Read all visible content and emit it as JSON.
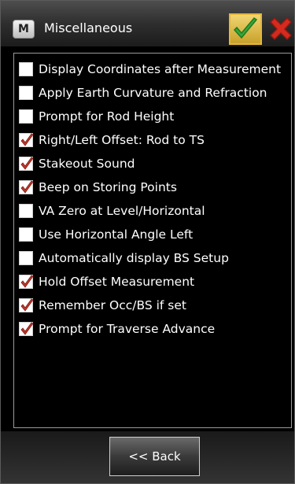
{
  "window": {
    "title": "Miscellaneous",
    "app_icon_letter": "M"
  },
  "toolbar": {
    "ok_icon": "checkmark-icon",
    "cancel_icon": "close-x-icon"
  },
  "options": [
    {
      "label": "Display Coordinates after Measurement",
      "checked": false
    },
    {
      "label": "Apply Earth Curvature and Refraction",
      "checked": false
    },
    {
      "label": "Prompt for Rod Height",
      "checked": false
    },
    {
      "label": "Right/Left Offset: Rod to TS",
      "checked": true
    },
    {
      "label": "Stakeout Sound",
      "checked": true
    },
    {
      "label": "Beep on Storing Points",
      "checked": true
    },
    {
      "label": "VA Zero at Level/Horizontal",
      "checked": false
    },
    {
      "label": "Use Horizontal Angle Left",
      "checked": false
    },
    {
      "label": "Automatically display BS Setup",
      "checked": false
    },
    {
      "label": "Hold Offset Measurement",
      "checked": true
    },
    {
      "label": "Remember Occ/BS if set",
      "checked": true
    },
    {
      "label": "Prompt for Traverse Advance",
      "checked": true
    }
  ],
  "footer": {
    "back_label": "<< Back"
  },
  "colors": {
    "check_mark": "#c0392b",
    "ok_green": "#3aa53a",
    "cancel_red": "#d42b1e"
  }
}
